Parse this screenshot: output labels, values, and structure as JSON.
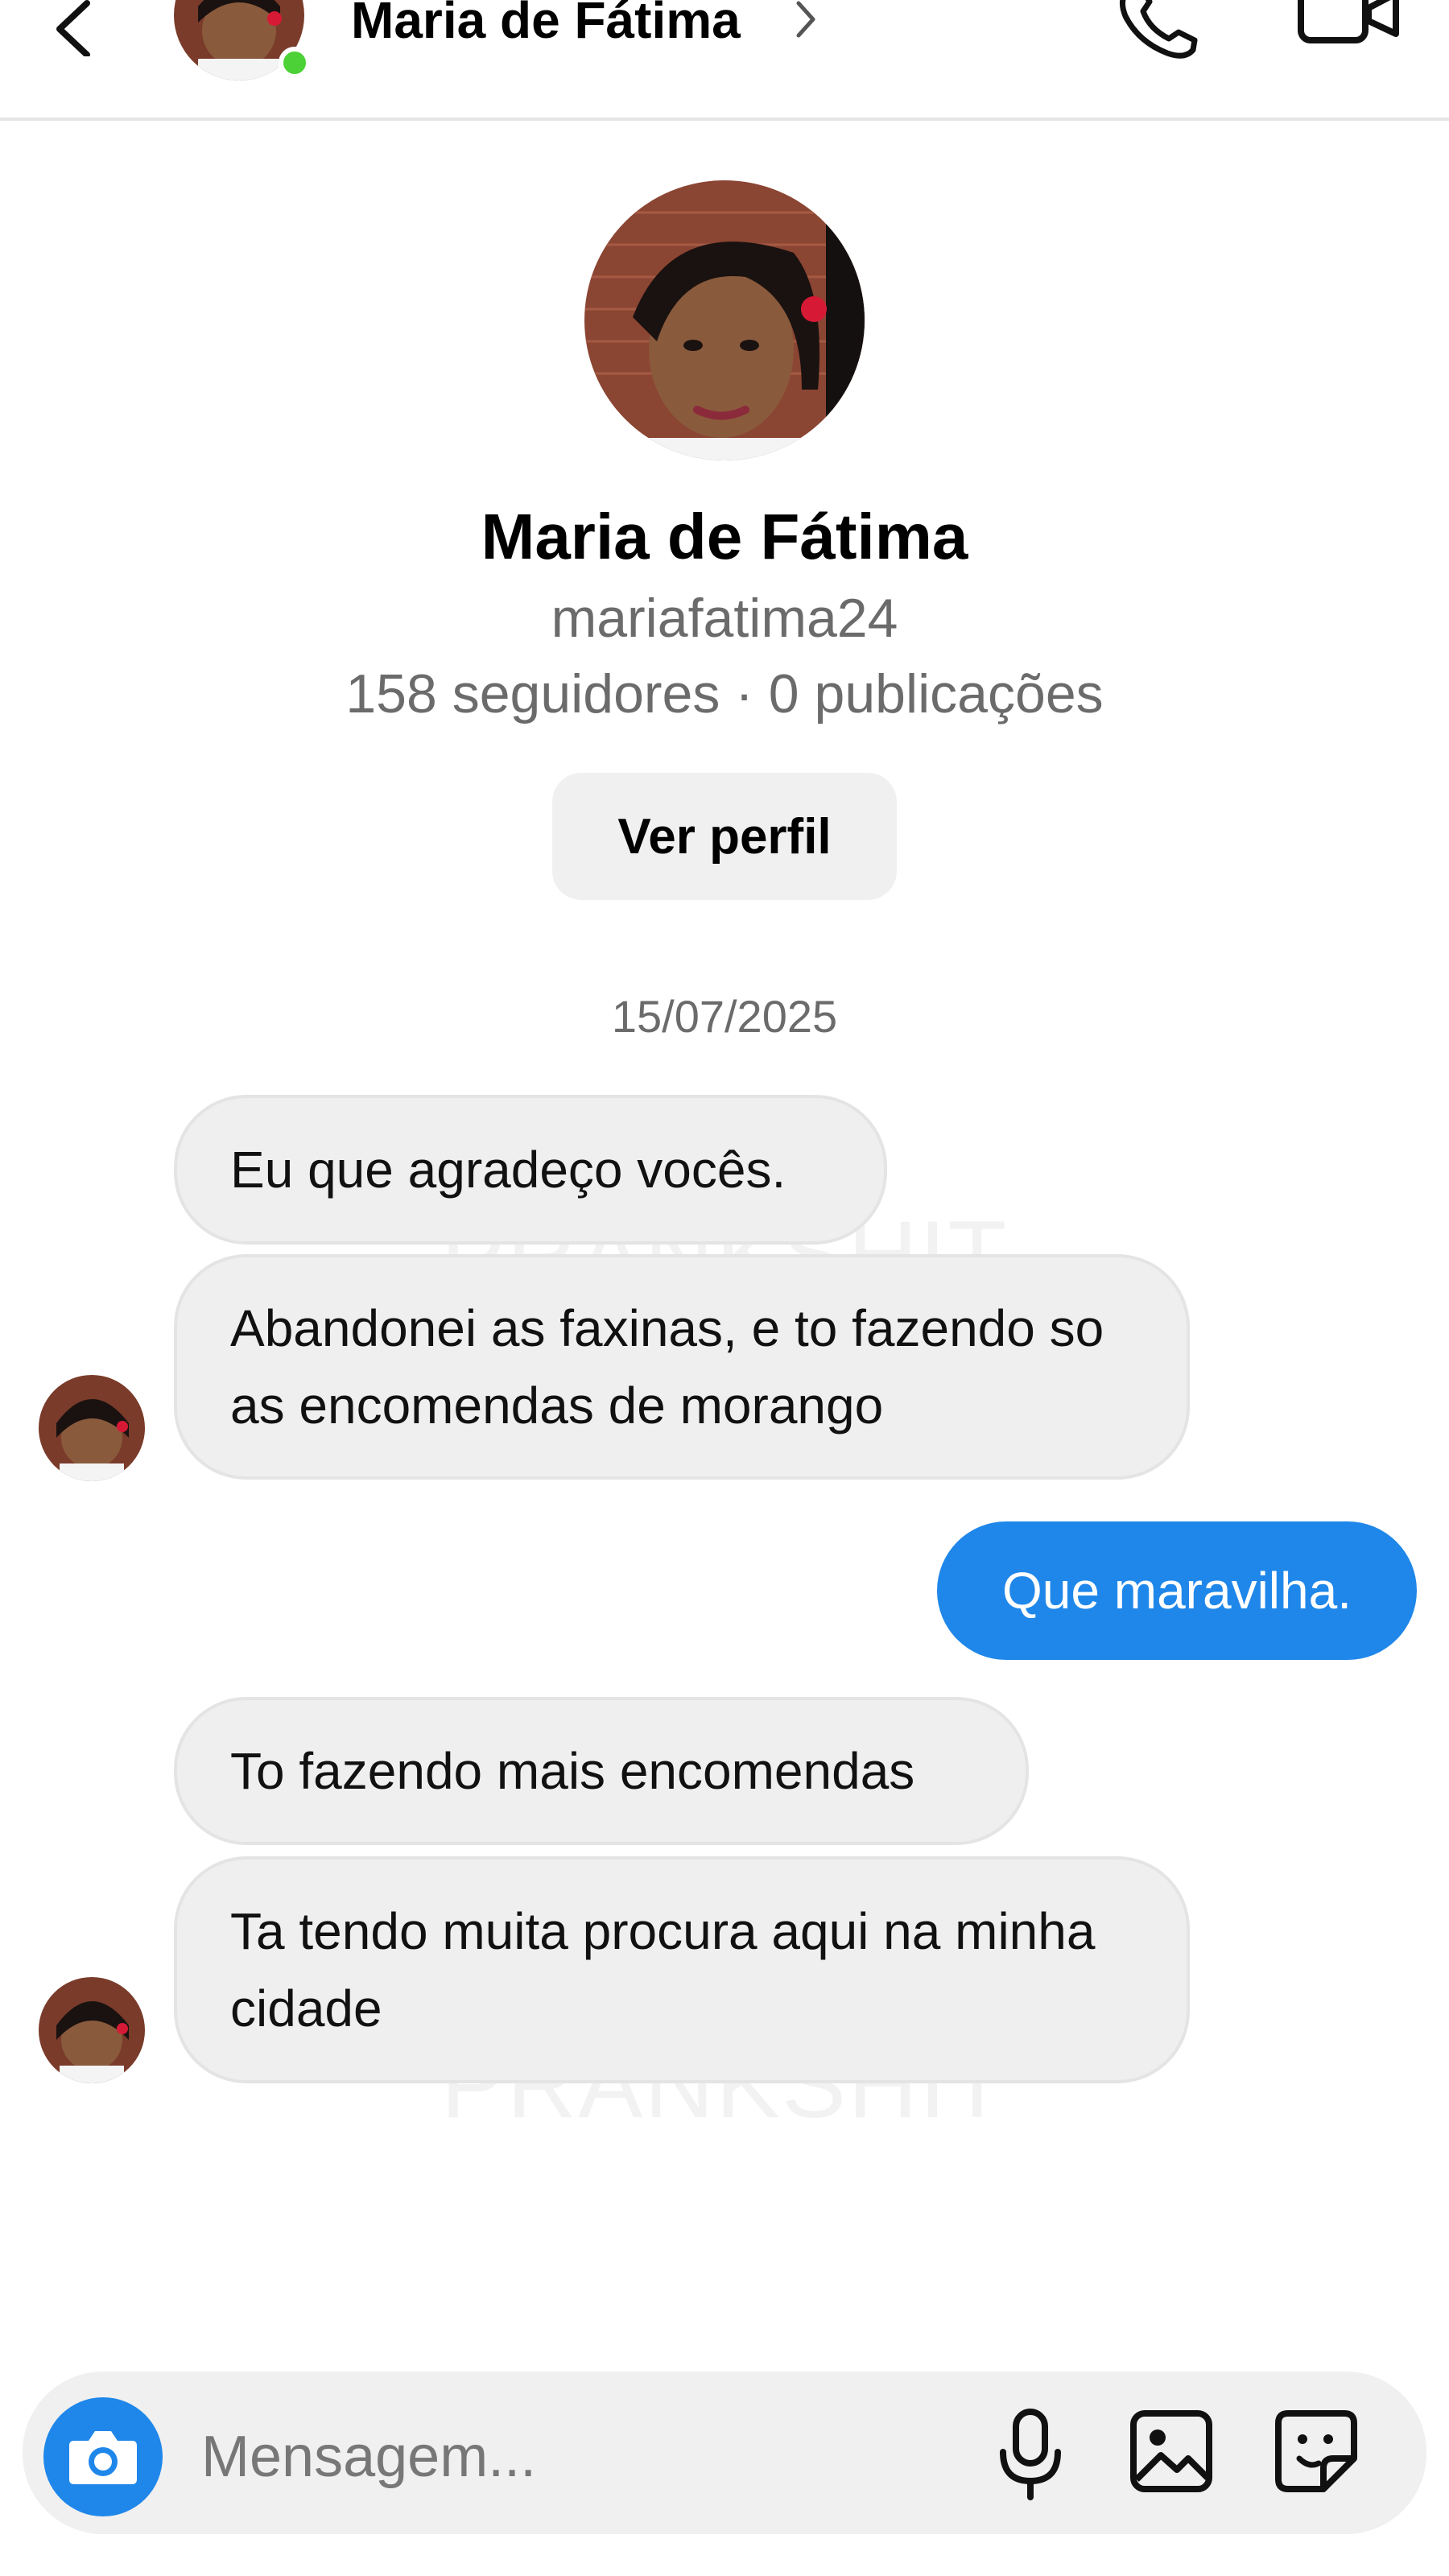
{
  "header": {
    "name": "Maria de Fátima",
    "online": true
  },
  "profile": {
    "name": "Maria de Fátima",
    "username": "mariafatima24",
    "stats": "158 seguidores · 0 publicações",
    "view_button": "Ver perfil"
  },
  "date": "15/07/2025",
  "messages": [
    {
      "from": "them",
      "text": "Eu que agradeço vocês."
    },
    {
      "from": "them",
      "text": "Abandonei as faxinas, e to fazendo so as encomendas de morango"
    },
    {
      "from": "me",
      "text": "Que maravilha."
    },
    {
      "from": "them",
      "text": "To fazendo mais encomendas"
    },
    {
      "from": "them",
      "text": "Ta tendo muita procura aqui na minha cidade"
    }
  ],
  "composer": {
    "placeholder": "Mensagem..."
  },
  "colors": {
    "accent": "#1f87ea",
    "online": "#4cd137",
    "incoming_bubble": "#efefef"
  },
  "icons": [
    "back-arrow-icon",
    "chevron-right-icon",
    "phone-icon",
    "video-camera-icon",
    "camera-icon",
    "microphone-icon",
    "gallery-icon",
    "sticker-icon"
  ]
}
